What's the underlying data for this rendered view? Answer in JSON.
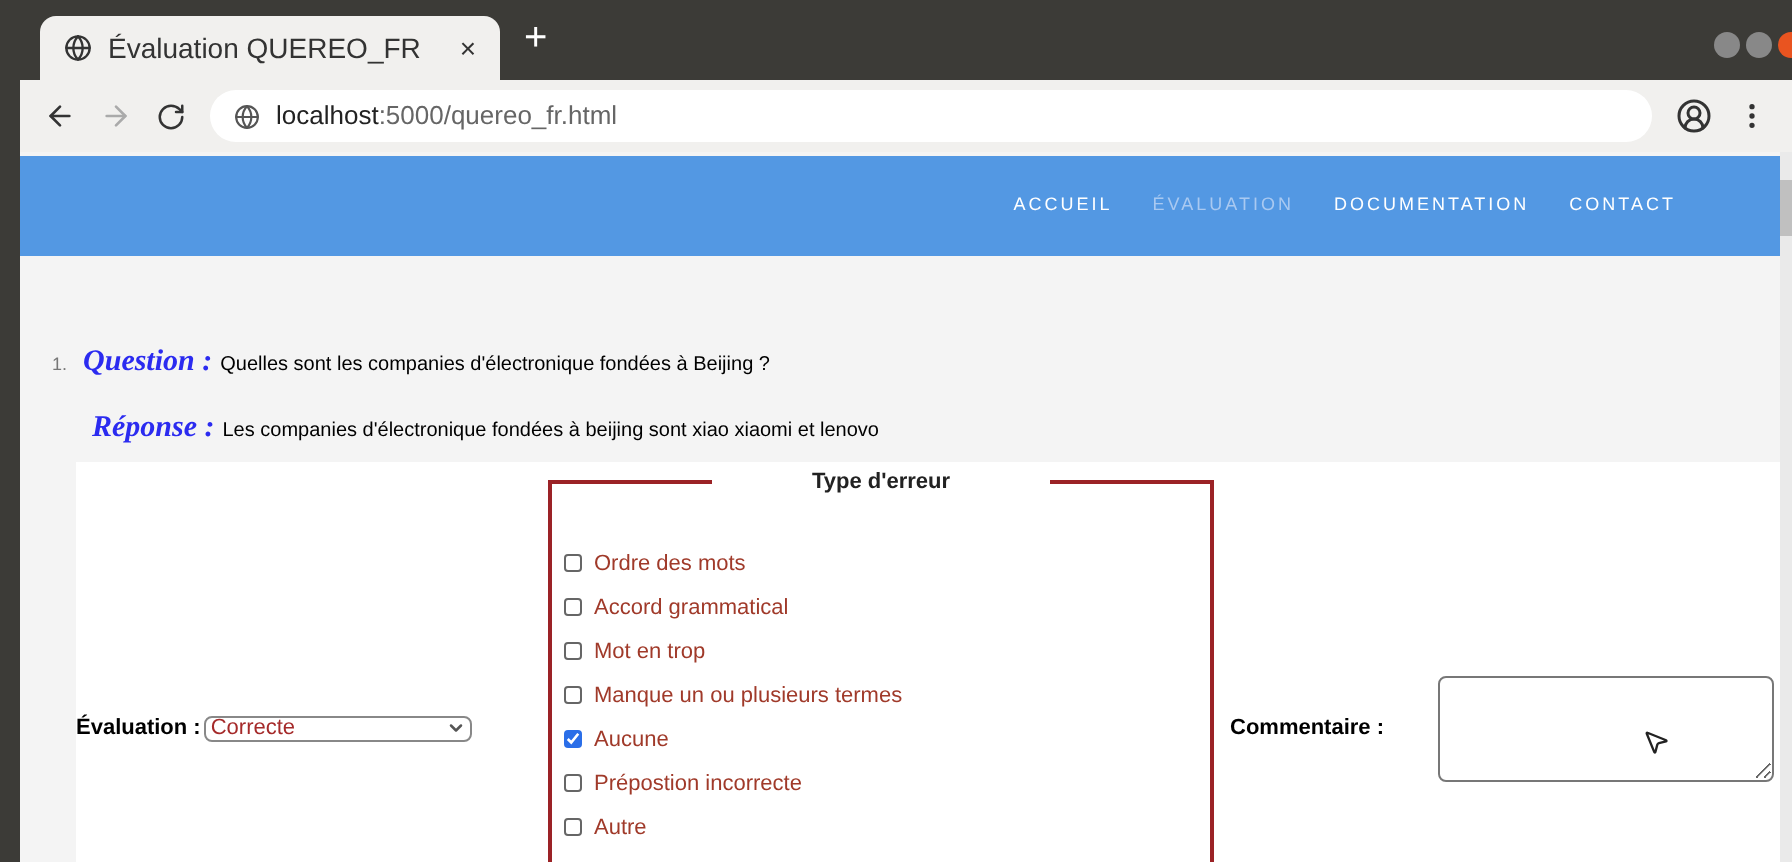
{
  "tab": {
    "title": "Évaluation QUEREO_FR",
    "close": "×",
    "new_tab": "+"
  },
  "address": {
    "host": "localhost",
    "path": ":5000/quereo_fr.html"
  },
  "nav": [
    {
      "label": "ACCUEIL",
      "selected": false
    },
    {
      "label": "ÉVALUATION",
      "selected": true
    },
    {
      "label": "DOCUMENTATION",
      "selected": false
    },
    {
      "label": "CONTACT",
      "selected": false
    }
  ],
  "item": {
    "number": "1.",
    "question_label": "Question :",
    "question": "Quelles sont les companies d'électronique fondées à Beijing ?",
    "answer_label": "Réponse :",
    "answer": "Les companies d'électronique fondées à beijing sont xiao xiaomi et lenovo"
  },
  "evaluation": {
    "label": "Évaluation :",
    "value": "Correcte"
  },
  "error_type": {
    "title": "Type d'erreur",
    "options": [
      {
        "label": "Ordre des mots",
        "checked": false
      },
      {
        "label": "Accord grammatical",
        "checked": false
      },
      {
        "label": "Mot en trop",
        "checked": false
      },
      {
        "label": "Manque un ou plusieurs termes",
        "checked": false
      },
      {
        "label": "Aucune",
        "checked": true
      },
      {
        "label": "Prépostion incorrecte",
        "checked": false
      },
      {
        "label": "Autre",
        "checked": false
      }
    ]
  },
  "comment": {
    "label": "Commentaire :"
  }
}
